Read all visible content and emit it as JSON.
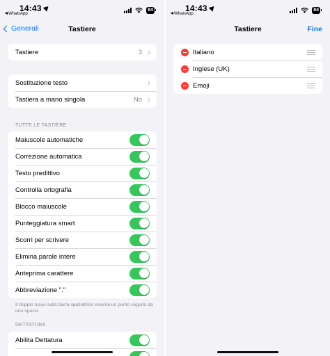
{
  "status": {
    "time": "14:43",
    "back_app": "WhatsApp",
    "battery": "84"
  },
  "left": {
    "nav": {
      "back_label": "Generali",
      "title": "Tastiere"
    },
    "keyboards_row": {
      "label": "Tastiere",
      "value": "3"
    },
    "text_group": [
      {
        "label": "Sostituzione testo",
        "value": ""
      },
      {
        "label": "Tastiera a mano singola",
        "value": "No"
      }
    ],
    "all_keyboards_header": "TUTTE LE TASTIERE",
    "toggles": [
      {
        "label": "Maiuscole automatiche",
        "on": true
      },
      {
        "label": "Correzione automatica",
        "on": true
      },
      {
        "label": "Testo predittivo",
        "on": true
      },
      {
        "label": "Controlla ortografia",
        "on": true
      },
      {
        "label": "Blocco maiuscole",
        "on": true
      },
      {
        "label": "Punteggiatura smart",
        "on": true
      },
      {
        "label": "Scorri per scrivere",
        "on": true
      },
      {
        "label": "Elimina parole intere",
        "on": true
      },
      {
        "label": "Anteprima carattere",
        "on": true
      },
      {
        "label": "Abbreviazione \".\"",
        "on": true
      }
    ],
    "footnote": "Il doppio tocco sulla barra spaziatrice inserirà un punto seguito da uno spazio.",
    "dictation_header": "DETTATURA",
    "dictation_rows": [
      {
        "label": "Abilita Dettatura",
        "on": true
      }
    ]
  },
  "right": {
    "nav": {
      "title": "Tastiere",
      "done_label": "Fine"
    },
    "keyboards": [
      {
        "label": "Italiano"
      },
      {
        "label": "Inglese (UK)"
      },
      {
        "label": "Emoji"
      }
    ]
  },
  "colors": {
    "accent": "#007aff",
    "toggle_on": "#34c759",
    "delete": "#ff3b30",
    "background": "#f2f2f7"
  }
}
